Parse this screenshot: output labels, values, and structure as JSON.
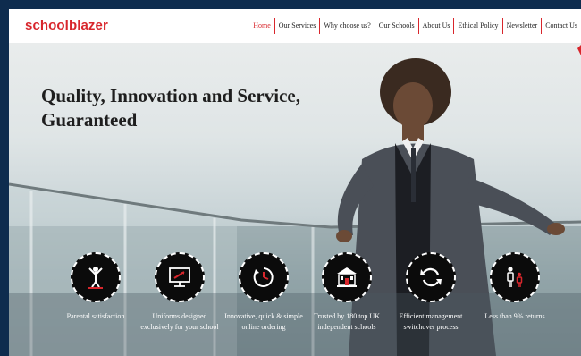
{
  "brand": {
    "logo_text": "schoolblazer",
    "accent": "#d8262c"
  },
  "nav": {
    "items": [
      {
        "label": "Home",
        "active": true
      },
      {
        "label": "Our Services",
        "active": false
      },
      {
        "label": "Why choose us?",
        "active": false
      },
      {
        "label": "Our Schools",
        "active": false
      },
      {
        "label": "About Us",
        "active": false
      },
      {
        "label": "Ethical Policy",
        "active": false
      },
      {
        "label": "Newsletter",
        "active": false
      },
      {
        "label": "Contact Us",
        "active": false
      }
    ]
  },
  "hero": {
    "headline": "Quality, Innovation and Service, Guaranteed"
  },
  "features": [
    {
      "icon": "trophy-person-icon",
      "label": "Parental satisfaction"
    },
    {
      "icon": "monitor-design-icon",
      "label": "Uniforms designed exclusively for your school"
    },
    {
      "icon": "clock-speed-icon",
      "label": "Innovative, quick & simple online ordering"
    },
    {
      "icon": "school-building-icon",
      "label": "Trusted by 180 top UK independent schools"
    },
    {
      "icon": "refresh-cycle-icon",
      "label": "Efficient management switchover process"
    },
    {
      "icon": "family-icon",
      "label": "Less than 9% returns"
    }
  ]
}
